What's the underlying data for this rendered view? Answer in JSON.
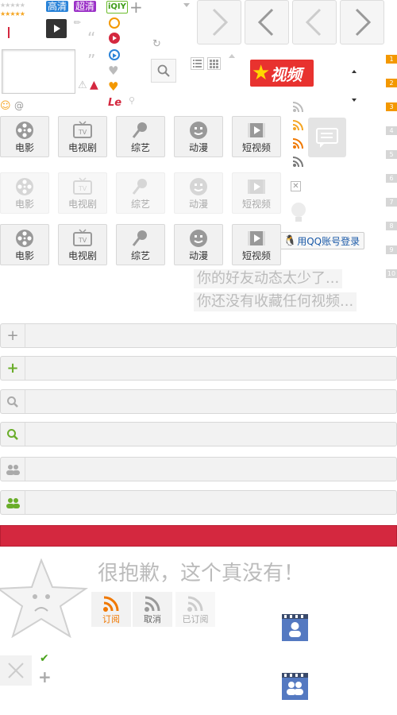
{
  "badges": {
    "hd": "高清",
    "super_hd": "超清",
    "iqiyi": "iQIY",
    "letv": "Le"
  },
  "categories": [
    {
      "id": "movie",
      "label": "电影",
      "icon": "film-reel-icon"
    },
    {
      "id": "tv",
      "label": "电视剧",
      "icon": "tv-icon"
    },
    {
      "id": "variety",
      "label": "综艺",
      "icon": "microphone-icon"
    },
    {
      "id": "anime",
      "label": "动漫",
      "icon": "smiley-face-icon"
    },
    {
      "id": "short",
      "label": "短视频",
      "icon": "play-video-icon"
    }
  ],
  "video_logo": {
    "text": "视频"
  },
  "qq_login": {
    "label": "用QQ账号登录"
  },
  "empty_messages": {
    "friends": "你的好友动态太少了...",
    "favorites": "你还没有收藏任何视频..."
  },
  "not_found": {
    "message": "很抱歉，这个真没有！"
  },
  "subscribe": {
    "subscribe": "订阅",
    "cancel": "取消",
    "subscribed": "已订阅"
  },
  "rank_numbers": [
    "1",
    "2",
    "3",
    "4",
    "5",
    "6",
    "7",
    "8",
    "9",
    "10"
  ],
  "emoticon_at": "@",
  "colors": {
    "accent": "#f39800",
    "danger": "#d4283f",
    "green": "#6aad2a",
    "blue": "#4a78c8"
  }
}
